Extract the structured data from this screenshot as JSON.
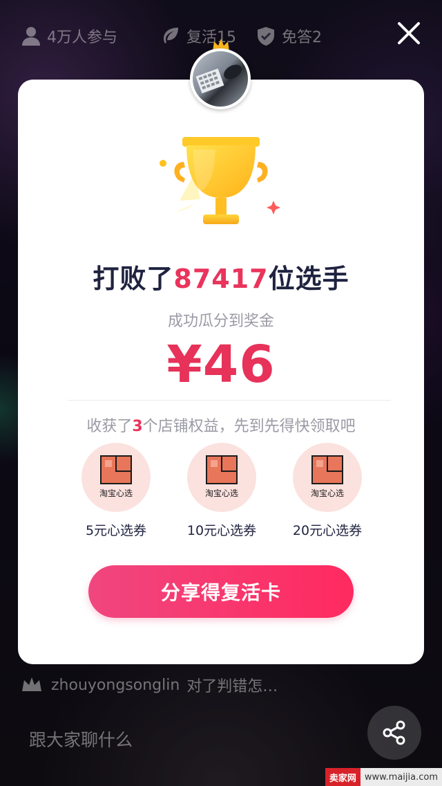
{
  "top_bar": {
    "participants": "4万人参与",
    "revive": "复活15",
    "exempt": "免答2"
  },
  "result": {
    "headline_prefix": "打败了",
    "defeated_count": "87417",
    "headline_suffix": "位选手",
    "subtitle": "成功瓜分到奖金",
    "amount": "¥46"
  },
  "benefits": {
    "prefix": "收获了",
    "count": "3",
    "suffix": "个店铺权益，先到先得快领取吧",
    "coupons": [
      {
        "label": "5元心选券",
        "brand": "淘宝心选"
      },
      {
        "label": "10元心选券",
        "brand": "淘宝心选"
      },
      {
        "label": "20元心选券",
        "brand": "淘宝心选"
      }
    ]
  },
  "share_button": {
    "label": "分享得复活卡"
  },
  "comment": {
    "user": "zhouyongsonglin",
    "text": "对了判错怎…"
  },
  "chat": {
    "placeholder": "跟大家聊什么"
  },
  "watermark": {
    "logo": "卖家网",
    "url": "www.maijia.com"
  },
  "colors": {
    "accent": "#e9345c",
    "button": "#ff2a5f",
    "coupon_bg": "#fbe2df",
    "coupon_logo": "#e8765a"
  }
}
